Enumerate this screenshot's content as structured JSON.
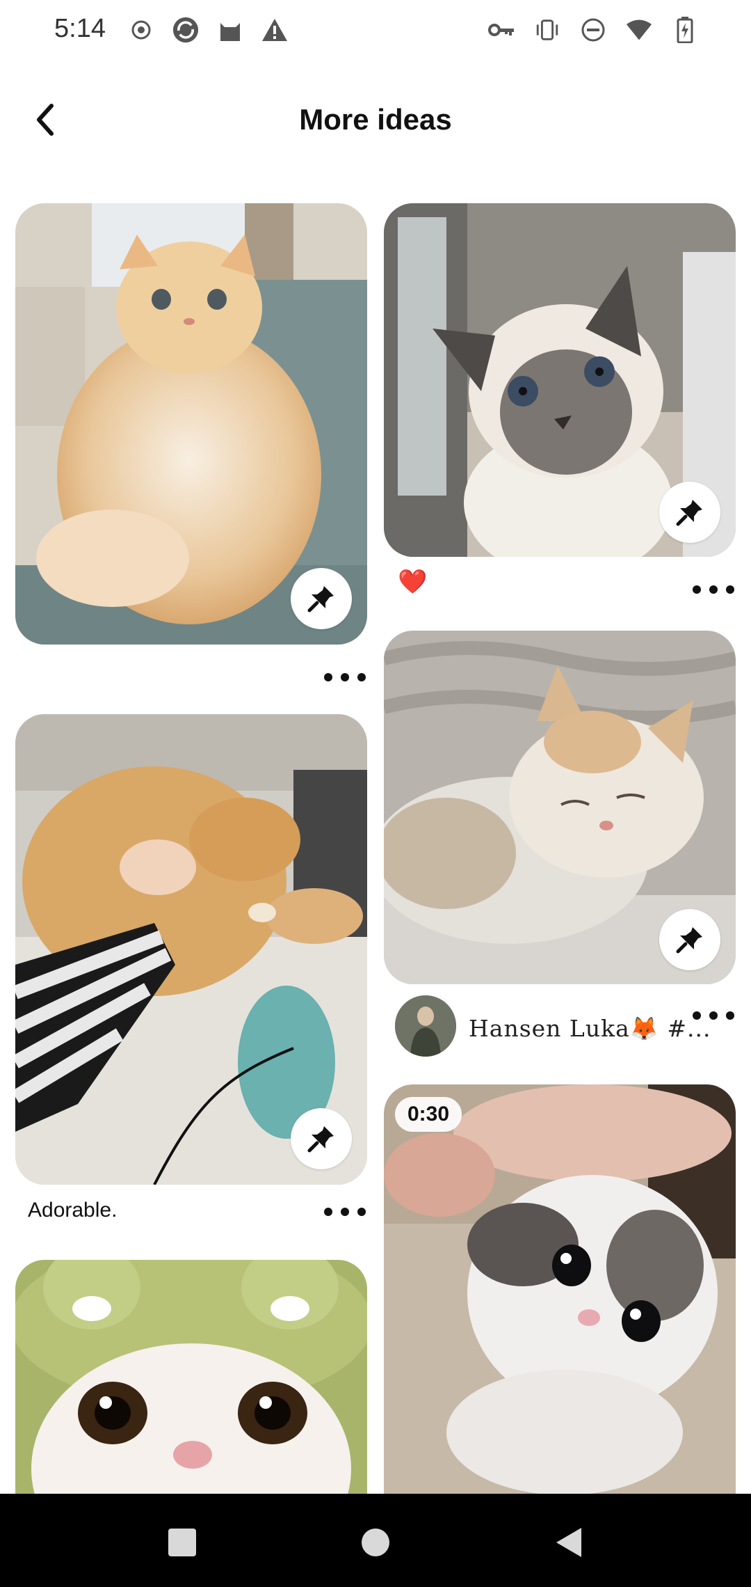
{
  "status_bar": {
    "time": "5:14",
    "left_icons": [
      "record-icon",
      "sync-app-icon",
      "cat-app-icon",
      "warning-icon"
    ],
    "right_icons": [
      "vpn-key-icon",
      "vibrate-icon",
      "do-not-disturb-icon",
      "wifi-icon",
      "battery-charging-icon"
    ]
  },
  "header": {
    "title": "More ideas",
    "back_icon": "back-chevron-icon"
  },
  "pins": [
    {
      "id": "fluffy-orange-cat",
      "caption": "",
      "save_icon": "pin-icon"
    },
    {
      "id": "siamese-cat",
      "caption": "❤️",
      "save_icon": "pin-icon"
    },
    {
      "id": "orange-cat-held",
      "caption": "Adorable.",
      "save_icon": "pin-icon"
    },
    {
      "id": "sleeping-kitten",
      "author": "Hansen Luka🦊 #...",
      "save_icon": "pin-icon"
    },
    {
      "id": "frog-hat-cat",
      "caption": ""
    },
    {
      "id": "grey-white-kitten-video",
      "duration": "0:30"
    }
  ],
  "nav_bar": {
    "items": [
      "recents-square-icon",
      "home-circle-icon",
      "back-triangle-icon"
    ]
  },
  "colors": {
    "background": "#ffffff",
    "nav_background": "#000000",
    "heart": "#b3202a"
  }
}
